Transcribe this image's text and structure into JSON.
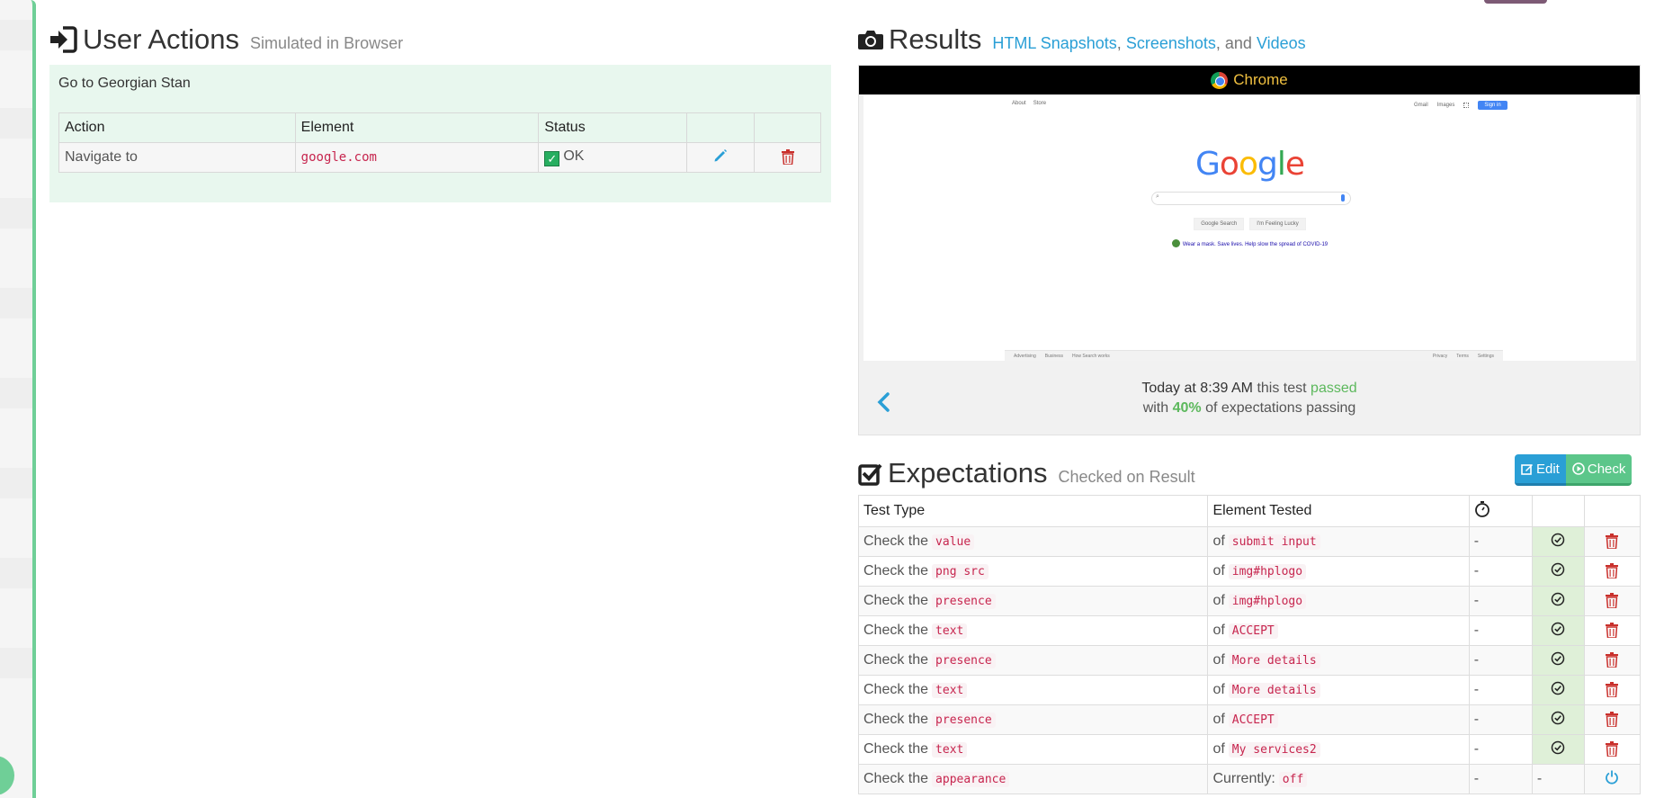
{
  "user_actions": {
    "title": "User Actions",
    "subtitle": "Simulated in Browser",
    "group_title": "Go to Georgian Stan",
    "columns": [
      "Action",
      "Element",
      "Status"
    ],
    "rows": [
      {
        "action": "Navigate to",
        "element": "google.com",
        "status": "OK"
      }
    ]
  },
  "results": {
    "title": "Results",
    "link_html": "HTML Snapshots",
    "sep1": ",",
    "link_screens": "Screenshots",
    "sep2": ", and",
    "link_videos": "Videos",
    "browser": "Chrome",
    "screenshot": {
      "top_left": [
        "About",
        "Store"
      ],
      "top_right": [
        "Gmail",
        "Images"
      ],
      "sign_in": "Sign in",
      "logo_letters": [
        "G",
        "o",
        "o",
        "g",
        "l",
        "e"
      ],
      "logo_colors": [
        "#4285f4",
        "#ea4335",
        "#fbbc05",
        "#4285f4",
        "#34a853",
        "#ea4335"
      ],
      "btn_search": "Google Search",
      "btn_lucky": "I'm Feeling Lucky",
      "note": "Wear a mask. Save lives. Help slow the spread of COVID-19",
      "footer_left": [
        "Advertising",
        "Business",
        "How Search works"
      ],
      "footer_right": [
        "Privacy",
        "Terms",
        "Settings"
      ]
    },
    "status_time": "Today at 8:39 AM",
    "status_mid": "this test",
    "status_result": "passed",
    "status_with": "with",
    "status_percent": "40%",
    "status_tail": "of expectations passing"
  },
  "expectations": {
    "title": "Expectations",
    "subtitle": "Checked on Result",
    "edit_label": "Edit",
    "check_label": "Check",
    "columns": [
      "Test Type",
      "Element Tested"
    ],
    "rows": [
      {
        "prefix": "Check the",
        "type": "value",
        "of": "of",
        "element": "submit input",
        "time": "-",
        "state": "check"
      },
      {
        "prefix": "Check the",
        "type": "png src",
        "of": "of",
        "element": "img#hplogo",
        "time": "-",
        "state": "check"
      },
      {
        "prefix": "Check the",
        "type": "presence",
        "of": "of",
        "element": "img#hplogo",
        "time": "-",
        "state": "check"
      },
      {
        "prefix": "Check the",
        "type": "text",
        "of": "of",
        "element": "ACCEPT",
        "time": "-",
        "state": "check"
      },
      {
        "prefix": "Check the",
        "type": "presence",
        "of": "of",
        "element": "More details",
        "time": "-",
        "state": "check"
      },
      {
        "prefix": "Check the",
        "type": "text",
        "of": "of",
        "element": "More details",
        "time": "-",
        "state": "check"
      },
      {
        "prefix": "Check the",
        "type": "presence",
        "of": "of",
        "element": "ACCEPT",
        "time": "-",
        "state": "check"
      },
      {
        "prefix": "Check the",
        "type": "text",
        "of": "of",
        "element": "My services2",
        "time": "-",
        "state": "check"
      },
      {
        "prefix": "Check the",
        "type": "appearance",
        "of": "Currently:",
        "element": "off",
        "time": "-",
        "state": "-"
      }
    ]
  },
  "colors": {
    "accent_green": "#6fcf97",
    "link_blue": "#2a9fd6",
    "code_red": "#c7254e",
    "pass_green": "#5cb85c",
    "trash_red": "#c9302c"
  }
}
